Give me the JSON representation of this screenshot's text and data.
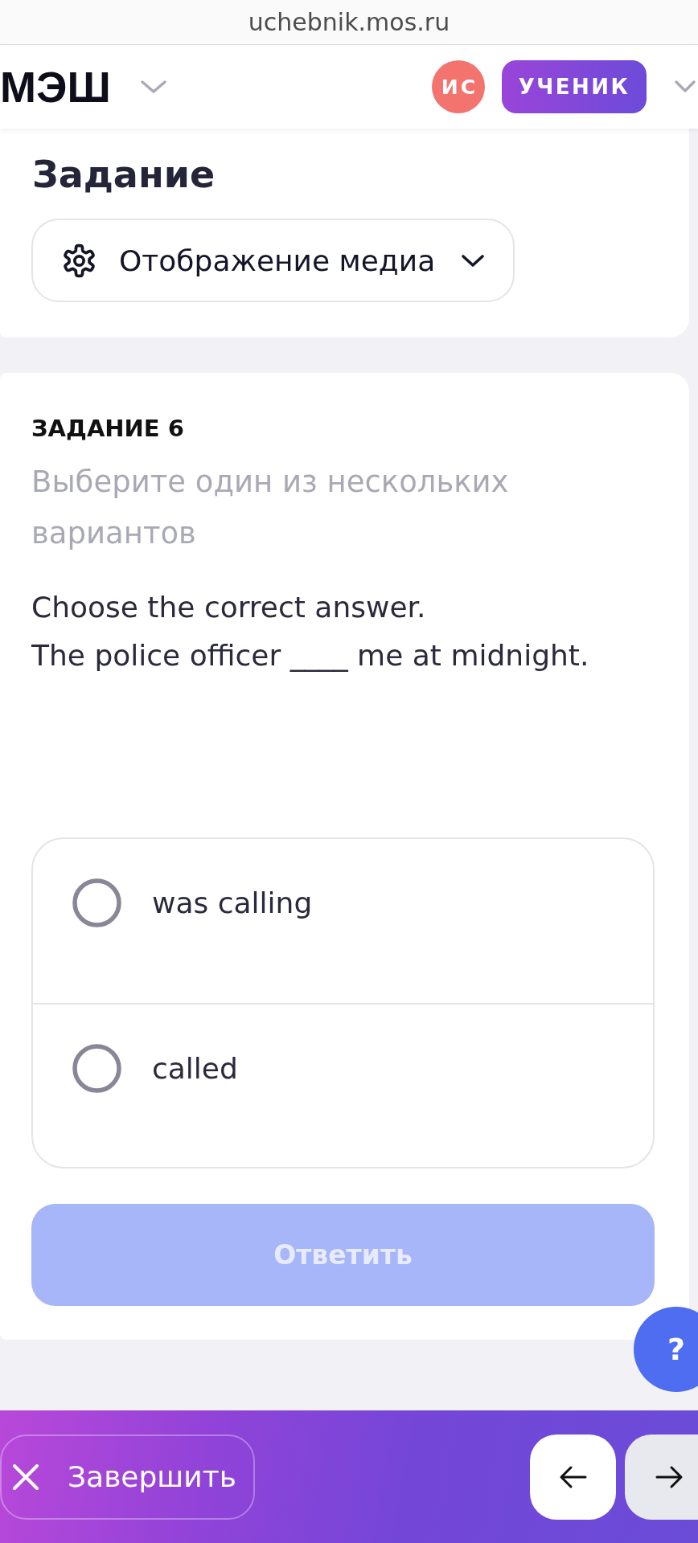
{
  "browser_bar": {
    "url": "uchebnik.mos.ru"
  },
  "header": {
    "logo": "МЭШ",
    "avatar_initials": "ИС",
    "role": "УЧЕНИК"
  },
  "title_card": {
    "title": "Задание",
    "media_button": {
      "label": "Отображение медиа"
    }
  },
  "task": {
    "label": "ЗАДАНИЕ 6",
    "instruction": "Выберите один из нескольких вариантов",
    "prompt": "Choose the correct answer.",
    "sentence": "The police officer ____ me at midnight.",
    "options": [
      {
        "label": "was calling",
        "selected": false
      },
      {
        "label": "called",
        "selected": false
      }
    ],
    "submit": {
      "label": "Ответить",
      "disabled": true
    }
  },
  "help_button": {
    "label": "?"
  },
  "bottom_bar": {
    "finish_label": "Завершить",
    "nav_buttons": [
      {
        "kind": "prev",
        "disabled": false
      },
      {
        "kind": "next",
        "disabled": true
      }
    ]
  }
}
